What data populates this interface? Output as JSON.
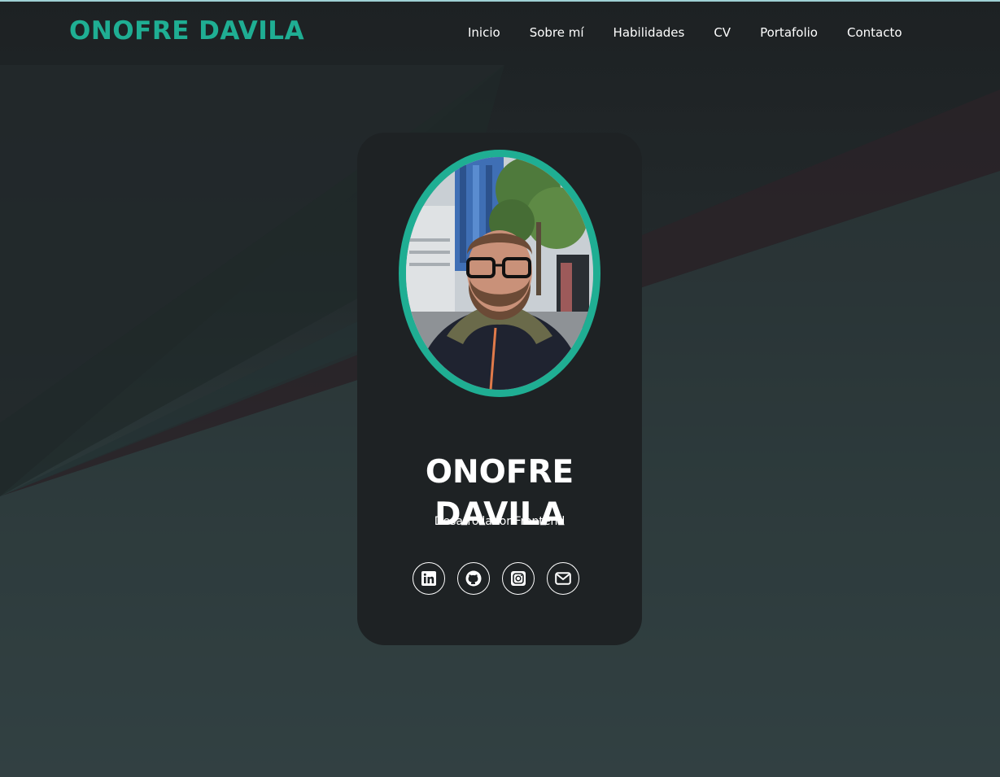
{
  "brand": {
    "name": "ONOFRE DAVILA",
    "color": "#1fae93"
  },
  "nav": {
    "items": [
      {
        "label": "Inicio"
      },
      {
        "label": "Sobre mí"
      },
      {
        "label": "Habilidades"
      },
      {
        "label": "CV"
      },
      {
        "label": "Portafolio"
      },
      {
        "label": "Contacto"
      }
    ]
  },
  "profile": {
    "name_line1": "ONOFRE",
    "name_line2": "DAVILA",
    "role": "Desarrollador Frontend",
    "photo_icon": "portrait-photo"
  },
  "socials": [
    {
      "icon": "linkedin-icon"
    },
    {
      "icon": "github-icon"
    },
    {
      "icon": "instagram-icon"
    },
    {
      "icon": "mail-icon"
    }
  ],
  "colors": {
    "accent": "#1fae93",
    "card_bg": "#1e2224",
    "text": "#ffffff"
  }
}
